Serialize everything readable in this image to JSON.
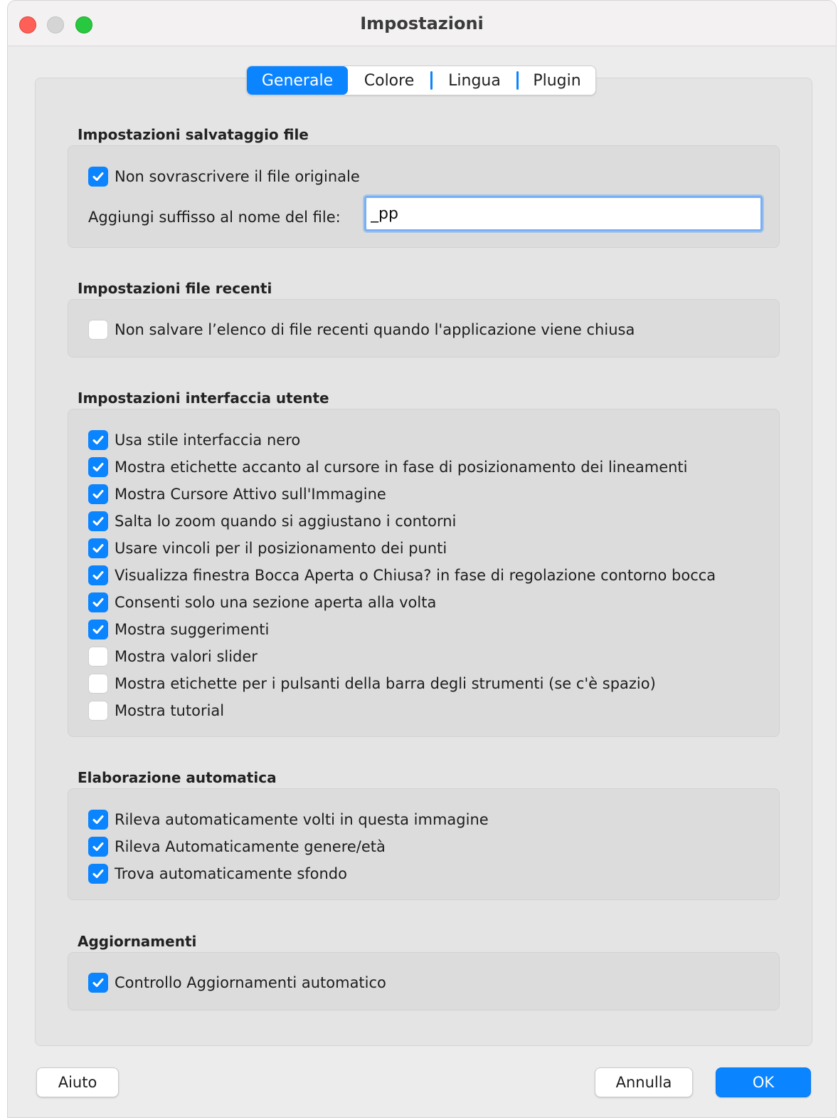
{
  "window": {
    "title": "Impostazioni"
  },
  "tabs": [
    {
      "label": "Generale",
      "active": true
    },
    {
      "label": "Colore",
      "active": false
    },
    {
      "label": "Lingua",
      "active": false
    },
    {
      "label": "Plugin",
      "active": false
    }
  ],
  "file_save": {
    "heading": "Impostazioni salvataggio file",
    "no_overwrite": {
      "label": "Non sovrascrivere il file originale",
      "checked": true
    },
    "suffix_label": "Aggiungi suffisso al nome del file:",
    "suffix_value": "_pp"
  },
  "recent_files": {
    "heading": "Impostazioni file recenti",
    "items": [
      {
        "label": "Non salvare l’elenco di file recenti quando l'applicazione viene chiusa",
        "checked": false
      }
    ]
  },
  "ui_settings": {
    "heading": "Impostazioni interfaccia utente",
    "items": [
      {
        "label": "Usa stile interfaccia nero",
        "checked": true
      },
      {
        "label": "Mostra etichette accanto al cursore in fase di posizionamento dei lineamenti",
        "checked": true
      },
      {
        "label": "Mostra Cursore Attivo sull'Immagine",
        "checked": true
      },
      {
        "label": "Salta lo zoom quando si aggiustano i contorni",
        "checked": true
      },
      {
        "label": "Usare vincoli per il posizionamento dei punti",
        "checked": true
      },
      {
        "label": "Visualizza finestra Bocca Aperta o Chiusa? in fase di regolazione contorno bocca",
        "checked": true
      },
      {
        "label": "Consenti solo una sezione aperta alla volta",
        "checked": true
      },
      {
        "label": "Mostra suggerimenti",
        "checked": true
      },
      {
        "label": "Mostra valori slider",
        "checked": false
      },
      {
        "label": "Mostra etichette per i pulsanti della barra degli strumenti (se c'è spazio)",
        "checked": false
      },
      {
        "label": "Mostra tutorial",
        "checked": false
      }
    ]
  },
  "auto_processing": {
    "heading": "Elaborazione automatica",
    "items": [
      {
        "label": "Rileva automaticamente volti in questa immagine",
        "checked": true
      },
      {
        "label": "Rileva Automaticamente genere/età",
        "checked": true
      },
      {
        "label": "Trova automaticamente sfondo",
        "checked": true
      }
    ]
  },
  "updates": {
    "heading": "Aggiornamenti",
    "items": [
      {
        "label": "Controllo Aggiornamenti automatico",
        "checked": true
      }
    ]
  },
  "buttons": {
    "help": "Aiuto",
    "cancel": "Annulla",
    "ok": "OK"
  },
  "colors": {
    "accent": "#0a84ff",
    "close": "#fe5f57",
    "maximize": "#28c840"
  }
}
